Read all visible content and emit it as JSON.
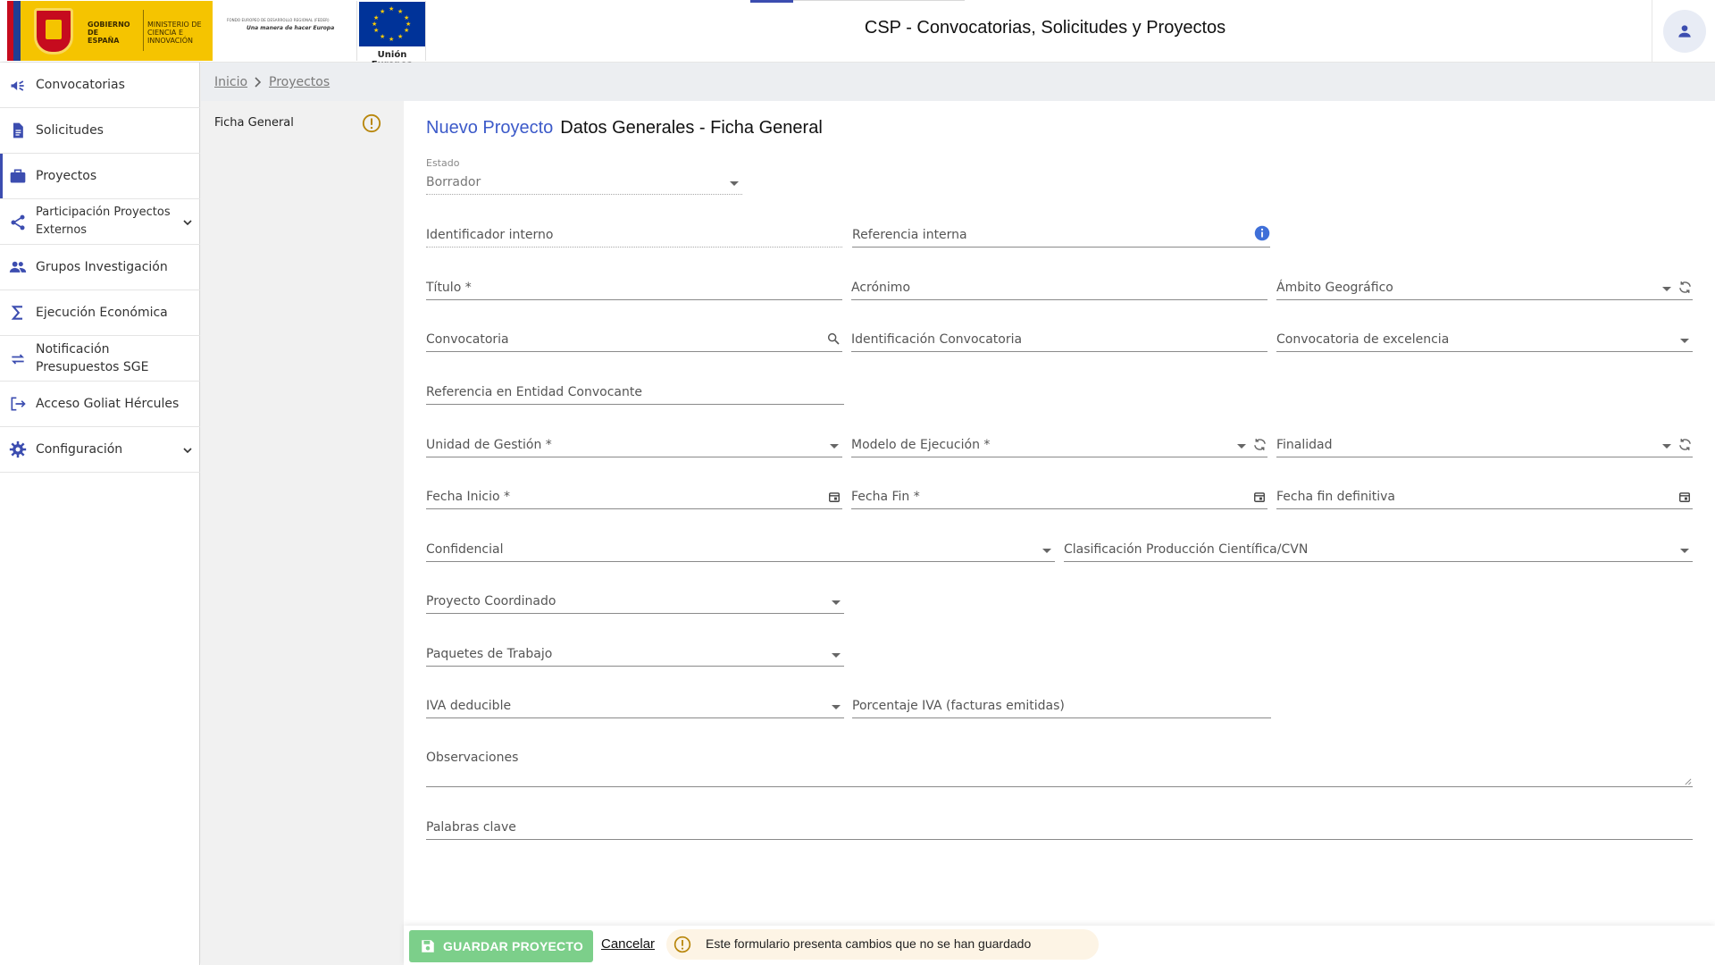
{
  "header": {
    "gobierno_text": "GOBIERNO DE ESPAÑA",
    "ministerio_text": "MINISTERIO DE CIENCIA E INNOVACIÓN",
    "feder_line1": "FONDO EUROPEO DE DESARROLLO REGIONAL (FEDER)",
    "feder_line2": "Una manera de hacer Europa",
    "eu_caption": "Unión Europea",
    "app_title": "CSP - Convocatorias, Solicitudes y Proyectos",
    "user_icon": "person-icon"
  },
  "sidebar": {
    "items": [
      {
        "label": "Convocatorias",
        "icon": "megaphone-icon"
      },
      {
        "label": "Solicitudes",
        "icon": "document-icon"
      },
      {
        "label": "Proyectos",
        "icon": "briefcase-icon"
      },
      {
        "label": "Participación Proyectos Externos",
        "icon": "share-icon"
      },
      {
        "label": "Grupos Investigación",
        "icon": "group-icon"
      },
      {
        "label": "Ejecución Económica",
        "icon": "sigma-icon"
      },
      {
        "label": "Notificación Presupuestos SGE",
        "icon": "swap-icon"
      },
      {
        "label": "Acceso Goliat Hércules",
        "icon": "exit-icon"
      },
      {
        "label": "Configuración",
        "icon": "gear-icon"
      }
    ]
  },
  "breadcrumb": {
    "home": "Inicio",
    "current": "Proyectos"
  },
  "subnav": {
    "item": "Ficha General"
  },
  "page": {
    "title_blue": "Nuevo Proyecto",
    "title_rest": "Datos Generales - Ficha General"
  },
  "form": {
    "estado_label": "Estado",
    "estado_value": "Borrador",
    "identificador_interno": "Identificador interno",
    "referencia_interna": "Referencia interna",
    "titulo": "Título *",
    "acronimo": "Acrónimo",
    "ambito_geografico": "Ámbito Geográfico",
    "convocatoria": "Convocatoria",
    "identificacion_convocatoria": "Identificación Convocatoria",
    "convocatoria_excelencia": "Convocatoria de excelencia",
    "referencia_entidad": "Referencia en Entidad Convocante",
    "unidad_gestion": "Unidad de Gestión *",
    "modelo_ejecucion": "Modelo de Ejecución *",
    "finalidad": "Finalidad",
    "fecha_inicio": "Fecha Inicio *",
    "fecha_fin": "Fecha Fin *",
    "fecha_fin_definitiva": "Fecha fin definitiva",
    "confidencial": "Confidencial",
    "clasificacion": "Clasificación Producción Científica/CVN",
    "proyecto_coordinado": "Proyecto Coordinado",
    "paquetes_trabajo": "Paquetes de Trabajo",
    "iva_deducible": "IVA deducible",
    "porcentaje_iva": "Porcentaje IVA (facturas emitidas)",
    "observaciones": "Observaciones",
    "palabras_clave": "Palabras clave"
  },
  "footer": {
    "save_label": "GUARDAR PROYECTO",
    "cancel_label": "Cancelar",
    "unsaved_message": "Este formulario presenta cambios que no se han guardado"
  },
  "colors": {
    "accent": "#3c5ac9",
    "sidebar_icon": "#3c4db0",
    "save_button": "#7ccf8a",
    "warning": "#b8860b",
    "info": "#3f6fd8"
  }
}
